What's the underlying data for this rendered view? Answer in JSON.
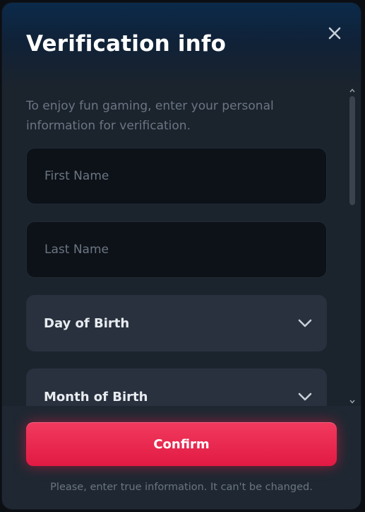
{
  "modal": {
    "title": "Verification info",
    "intro": "To enjoy fun gaming, enter your personal information for verification."
  },
  "form": {
    "first_name": {
      "placeholder": "First Name",
      "value": ""
    },
    "last_name": {
      "placeholder": "Last Name",
      "value": ""
    },
    "day_of_birth": {
      "label": "Day of Birth"
    },
    "month_of_birth": {
      "label": "Month of Birth"
    }
  },
  "footer": {
    "confirm_label": "Confirm",
    "note": "Please, enter true information. It can't be changed."
  },
  "icons": {
    "close": "close-icon",
    "dropdown": "chevron-down-icon",
    "scroll_up": "scroll-up-arrow-icon",
    "scroll_down": "scroll-down-arrow-icon"
  },
  "colors": {
    "accent": "#e8244c",
    "panel": "#1b232d",
    "header_gradient_top": "#0b2a4a",
    "input_bg": "#0d1218",
    "select_bg": "#28313d",
    "muted_text": "#6b7684"
  }
}
